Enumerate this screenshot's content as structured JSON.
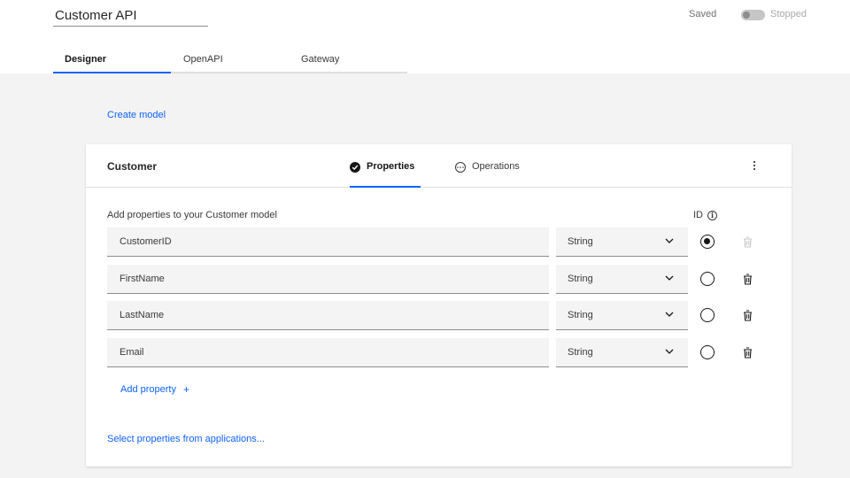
{
  "header": {
    "api_title": "Customer API",
    "saved_status": "Saved",
    "toggle_label": "Stopped"
  },
  "main_tabs": [
    {
      "label": "Designer",
      "active": true
    },
    {
      "label": "OpenAPI",
      "active": false
    },
    {
      "label": "Gateway",
      "active": false
    }
  ],
  "create_model_link": "Create model",
  "model": {
    "name": "Customer",
    "tabs": [
      {
        "label": "Properties",
        "icon": "checkmark-filled-icon",
        "active": true
      },
      {
        "label": "Operations",
        "icon": "overflow-circle-icon",
        "active": false
      }
    ],
    "instructions": "Add properties to your Customer model",
    "id_column_label": "ID",
    "properties": [
      {
        "name": "CustomerID",
        "type": "String",
        "is_id": true
      },
      {
        "name": "FirstName",
        "type": "String",
        "is_id": false
      },
      {
        "name": "LastName",
        "type": "String",
        "is_id": false
      },
      {
        "name": "Email",
        "type": "String",
        "is_id": false
      }
    ],
    "add_property_link": "Add property",
    "add_property_icon": "+",
    "select_from_apps_link": "Select properties from applications..."
  },
  "colors": {
    "accent": "#0f62fe",
    "background": "#f3f3f3",
    "field_bg": "#f4f4f4"
  }
}
